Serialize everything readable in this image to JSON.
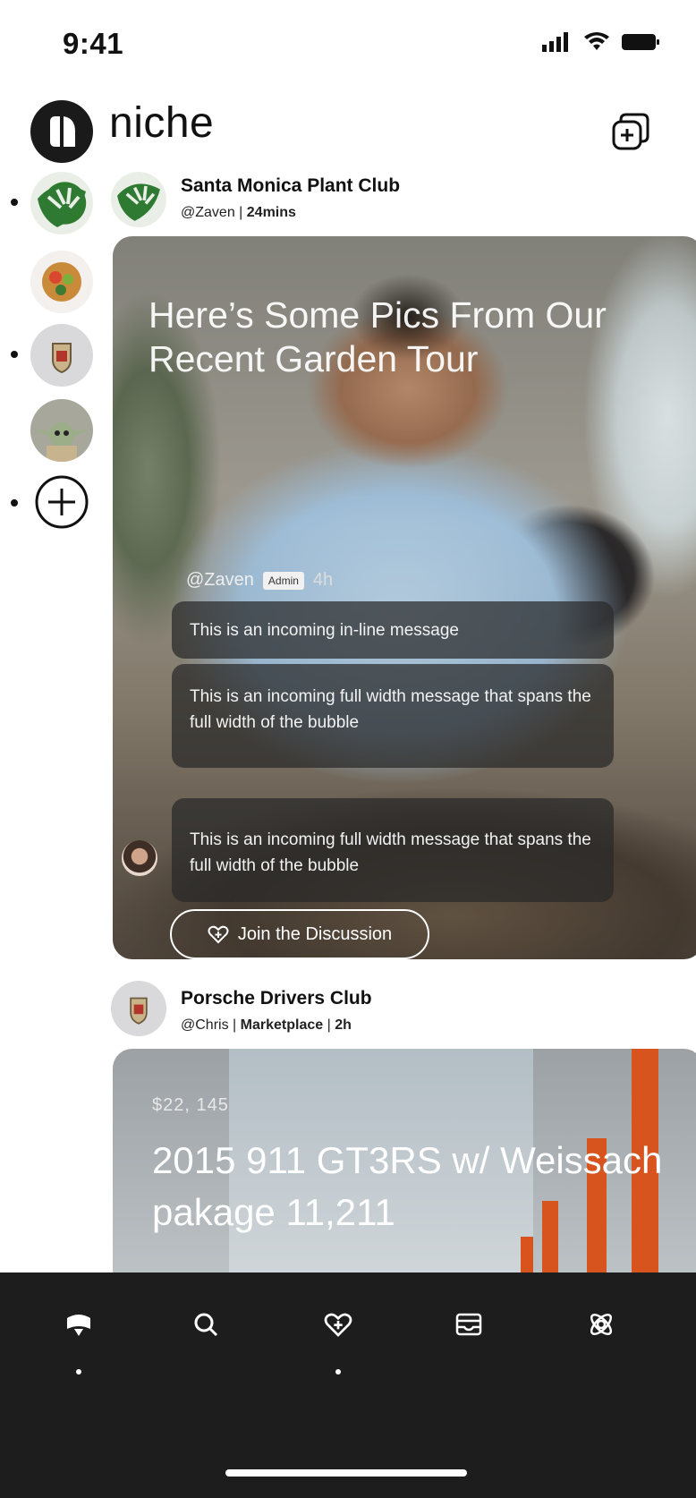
{
  "status_bar": {
    "time": "9:41"
  },
  "header": {
    "app_name": "niche",
    "compose_icon": "new-post-icon"
  },
  "sidebar": {
    "communities": [
      {
        "name": "monstera-leaf",
        "has_unread": true
      },
      {
        "name": "salad-bowl",
        "has_unread": false
      },
      {
        "name": "porsche-crest",
        "has_unread": true
      },
      {
        "name": "baby-yoda",
        "has_unread": false
      }
    ],
    "add_icon": "plus-circle-icon"
  },
  "feed": {
    "post1": {
      "community": "Santa Monica Plant Club",
      "author": "@Zaven",
      "time": "24mins",
      "separator": "|",
      "headline": "Here’s Some Pics From Our Recent Garden Tour",
      "message_author": "@Zaven",
      "message_badge": "Admin",
      "message_time": "4h",
      "messages": [
        "This is an incoming in-line message",
        "This is an incoming full width message that spans the full width of the bubble",
        "This is an incoming full width message that spans the full width of the bubble"
      ],
      "join_label": "Join the Discussion"
    },
    "post2": {
      "community": "Porsche Drivers Club",
      "author": "@Chris",
      "category": "Marketplace",
      "time": "2h",
      "separator": "|",
      "price": "$22, 145",
      "headline": "2015 911 GT3RS w/ Weissach pakage 11,211"
    }
  },
  "tabbar": {
    "tabs": [
      {
        "icon": "home-icon",
        "active": true
      },
      {
        "icon": "search-icon",
        "active": false
      },
      {
        "icon": "heart-add-icon",
        "active": false,
        "has_dot": true
      },
      {
        "icon": "inbox-icon",
        "active": false
      },
      {
        "icon": "atom-icon",
        "active": false
      }
    ]
  },
  "colors": {
    "background": "#ffffff",
    "tabbar": "#1d1d1d",
    "accent_orange": "#d8541f"
  }
}
